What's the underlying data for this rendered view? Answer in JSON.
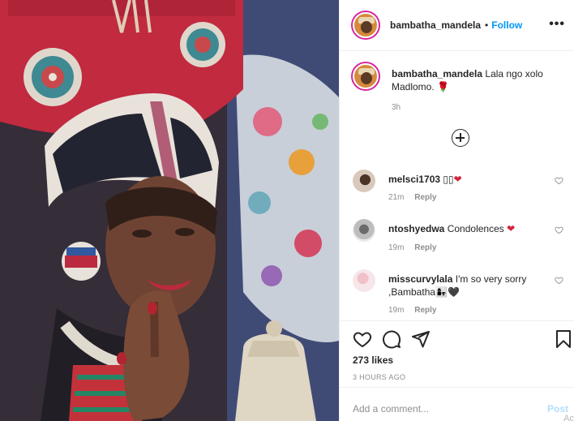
{
  "post": {
    "image_subject": "woman in traditional beaded headdress",
    "author": "bambatha_mandela",
    "follow_label": "Follow",
    "dot": "•",
    "more_label": "•••"
  },
  "caption": {
    "username": "bambatha_mandela",
    "text": "Lala ngo xolo Madlomo.",
    "emoji": "🌹",
    "time": "3h"
  },
  "comments": [
    {
      "username": "melsci1703",
      "text": "▯▯",
      "emoji": "❤",
      "time": "21m",
      "reply": "Reply"
    },
    {
      "username": "ntoshyedwa",
      "text": "Condolences",
      "emoji": "❤",
      "time": "19m",
      "reply": "Reply"
    },
    {
      "username": "misscurvylala",
      "text": "I'm so very sorry ,Bambatha",
      "emoji": "👩‍👧🖤",
      "time": "19m",
      "reply": "Reply"
    }
  ],
  "actions": {
    "likes": "273 likes",
    "posted": "3 HOURS AGO",
    "icons": [
      "heart-icon",
      "comment-icon",
      "share-icon",
      "bookmark-icon"
    ]
  },
  "add_comment": {
    "placeholder": "Add a comment...",
    "post_label": "Post",
    "watermark": "Ac"
  },
  "colors": {
    "link": "#0095f6",
    "heart": "#d3243b",
    "muted": "#8e8e8e"
  }
}
